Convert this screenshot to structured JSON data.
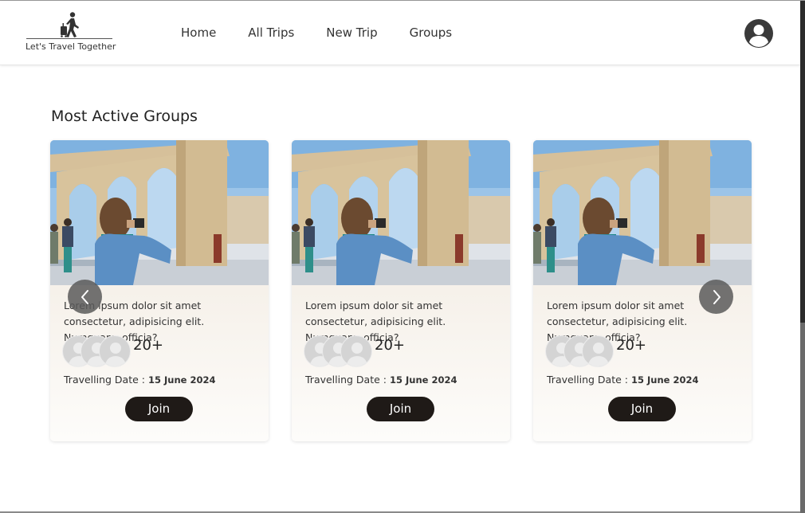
{
  "header": {
    "logo_tagline": "Let's Travel Together",
    "nav": [
      "Home",
      "All Trips",
      "New Trip",
      "Groups"
    ],
    "profile_icon": "account-circle-icon"
  },
  "section": {
    "title": "Most Active Groups"
  },
  "cards": [
    {
      "description": "Lorem ipsum dolor sit amet consectetur, adipisicing elit. Numquam, officia?",
      "member_count": "20+",
      "travel_label": "Travelling Date : ",
      "travel_date": "15 June 2024",
      "join_label": "Join"
    },
    {
      "description": "Lorem ipsum dolor sit amet consectetur, adipisicing elit. Numquam, officia?",
      "member_count": "20+",
      "travel_label": "Travelling Date : ",
      "travel_date": "15 June 2024",
      "join_label": "Join"
    },
    {
      "description": "Lorem ipsum dolor sit amet consectetur, adipisicing elit. Numquam, officia?",
      "member_count": "20+",
      "travel_label": "Travelling Date : ",
      "travel_date": "15 June 2024",
      "join_label": "Join"
    }
  ],
  "carousel": {
    "prev_icon": "chevron-left-icon",
    "next_icon": "chevron-right-icon"
  },
  "colors": {
    "join_button": "#1f1a17",
    "card_gradient_top": "#efe7dc",
    "arrow_bg": "#5a5a5a"
  }
}
